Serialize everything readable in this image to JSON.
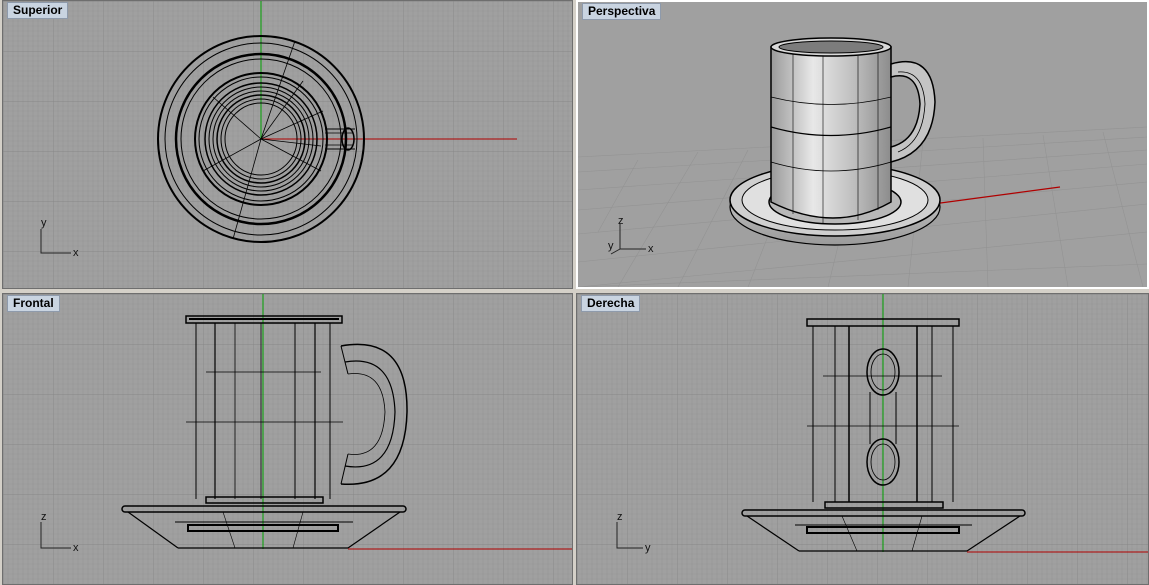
{
  "viewports": {
    "top": {
      "title": "Superior",
      "axis_h": "x",
      "axis_v": "y"
    },
    "persp": {
      "title": "Perspectiva",
      "axis_h": "x",
      "axis_v": "z",
      "axis_d": "y"
    },
    "front": {
      "title": "Frontal",
      "axis_h": "x",
      "axis_v": "z"
    },
    "right": {
      "title": "Derecha",
      "axis_h": "y",
      "axis_v": "z"
    }
  },
  "colors": {
    "background": "#a0a0a0",
    "grid_minor": "#979797",
    "grid_major": "#8a8a8a",
    "axis_x": "#b00000",
    "axis_y": "#00a000",
    "wire": "#000000",
    "label_bg": "#c9d4e1"
  }
}
